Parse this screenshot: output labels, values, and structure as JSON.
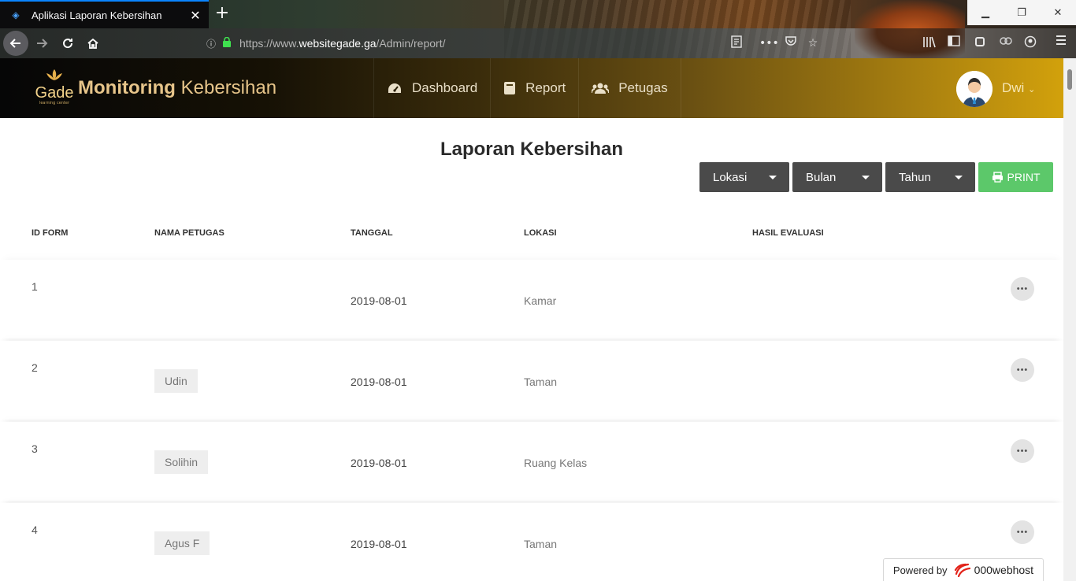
{
  "browser": {
    "tab_title": "Aplikasi Laporan Kebersihan",
    "url_prefix": "https://www.",
    "url_domain": "websitegade.ga",
    "url_path": "/Admin/report/"
  },
  "header": {
    "logo_text": "Gade",
    "logo_sub": "learning center",
    "brand_bold": "Monitoring",
    "brand_light": "Kebersihan",
    "menu": [
      {
        "label": "Dashboard",
        "icon": "dashboard-icon"
      },
      {
        "label": "Report",
        "icon": "book-icon"
      },
      {
        "label": "Petugas",
        "icon": "users-icon"
      }
    ],
    "user_name": "Dwi"
  },
  "page": {
    "title": "Laporan Kebersihan",
    "filters": {
      "lokasi": "Lokasi",
      "bulan": "Bulan",
      "tahun": "Tahun"
    },
    "print_label": "PRINT"
  },
  "table": {
    "headers": [
      "ID FORM",
      "NAMA PETUGAS",
      "TANGGAL",
      "LOKASI",
      "HASIL EVALUASI"
    ],
    "rows": [
      {
        "id": "1",
        "name": "",
        "date": "2019-08-01",
        "location": "Kamar"
      },
      {
        "id": "2",
        "name": "Udin",
        "date": "2019-08-01",
        "location": "Taman"
      },
      {
        "id": "3",
        "name": "Solihin",
        "date": "2019-08-01",
        "location": "Ruang Kelas"
      },
      {
        "id": "4",
        "name": "Agus F",
        "date": "2019-08-01",
        "location": "Taman"
      }
    ]
  },
  "footer": {
    "powered_by": "Powered by",
    "host": "000webhost"
  },
  "colors": {
    "print_green": "#5cc86a",
    "dropdown_gray": "#4a4a4a",
    "header_gold": "#d2a10c"
  }
}
